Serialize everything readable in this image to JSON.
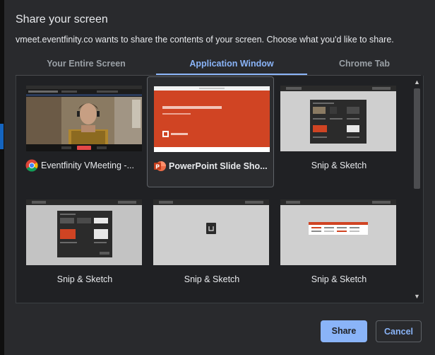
{
  "dialog": {
    "title": "Share your screen",
    "subtitle": "vmeet.eventfinity.co wants to share the contents of your screen. Choose what you'd like to share."
  },
  "tabs": [
    {
      "label": "Your Entire Screen",
      "active": false
    },
    {
      "label": "Application Window",
      "active": true
    },
    {
      "label": "Chrome Tab",
      "active": false
    }
  ],
  "windows": [
    {
      "label": "Eventfinity VMeeting -...",
      "icon": "chrome-icon",
      "selected": false
    },
    {
      "label": "PowerPoint Slide Sho...",
      "icon": "powerpoint-icon",
      "selected": true
    },
    {
      "label": "Snip & Sketch",
      "icon": "",
      "selected": false
    },
    {
      "label": "Snip & Sketch",
      "icon": "",
      "selected": false
    },
    {
      "label": "Snip & Sketch",
      "icon": "",
      "selected": false
    },
    {
      "label": "Snip & Sketch",
      "icon": "",
      "selected": false
    }
  ],
  "buttons": {
    "share_label": "Share",
    "cancel_label": "Cancel"
  },
  "colors": {
    "accent": "#8ab4f8",
    "dialog_bg": "#292a2d",
    "panel_bg": "#202124",
    "ppt_orange": "#d04423"
  }
}
